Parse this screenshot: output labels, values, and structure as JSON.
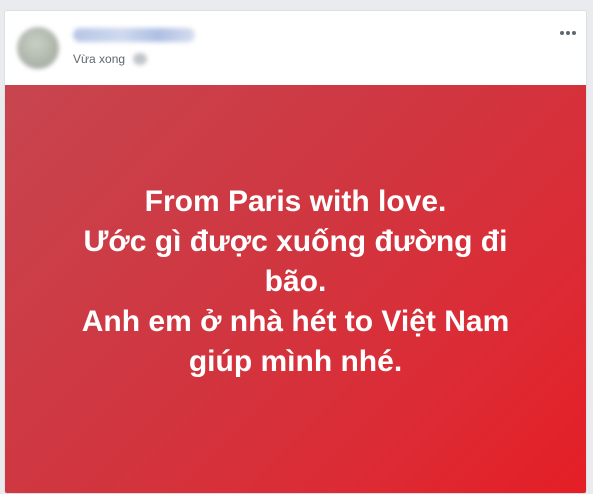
{
  "post": {
    "timestamp": "Vừa xong",
    "more_options_icon": "ellipsis-icon",
    "background_colors": [
      "#c7454f",
      "#e51e25"
    ],
    "text_color": "#ffffff",
    "message_lines": [
      "From Paris with love.",
      "Ước gì được xuống đường đi",
      "bão.",
      "Anh em ở nhà hét to Việt Nam",
      "giúp mình nhé."
    ]
  }
}
